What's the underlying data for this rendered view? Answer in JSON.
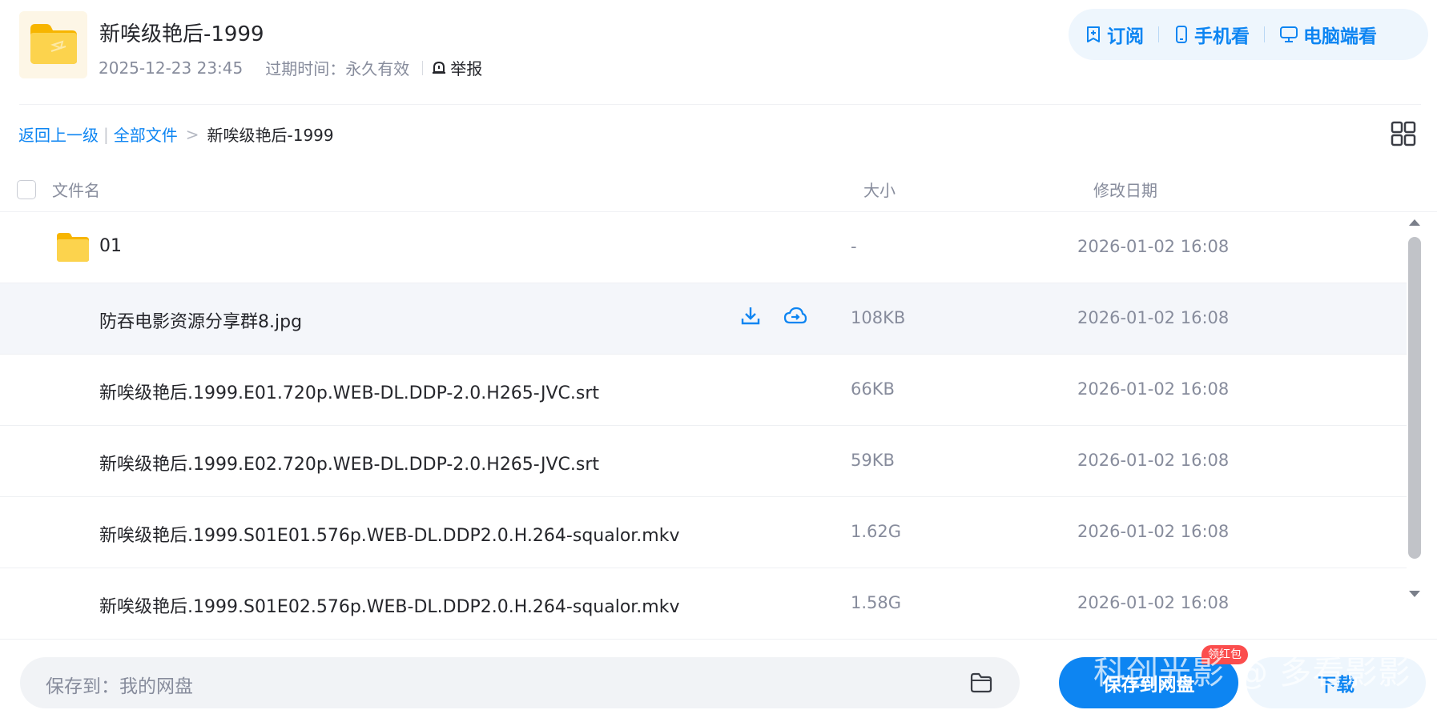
{
  "share": {
    "title": "新唉级艳后-1999",
    "created": "2025-12-23 23:45",
    "expire_label": "过期时间：永久有效",
    "report_label": "举报"
  },
  "top_actions": {
    "subscribe": "订阅",
    "mobile": "手机看",
    "desktop": "电脑端看"
  },
  "breadcrumb": {
    "back": "返回上一级",
    "all_files": "全部文件",
    "current": "新唉级艳后-1999"
  },
  "table": {
    "headers": {
      "name": "文件名",
      "size": "大小",
      "date": "修改日期"
    },
    "rows": [
      {
        "name": "01",
        "size": "-",
        "date": "2026-01-02 16:08",
        "type": "folder"
      },
      {
        "name": "防吞电影资源分享群8.jpg",
        "size": "108KB",
        "date": "2026-01-02 16:08",
        "type": "file"
      },
      {
        "name": "新唉级艳后.1999.E01.720p.WEB-DL.DDP-2.0.H265-JVC.srt",
        "size": "66KB",
        "date": "2026-01-02 16:08",
        "type": "file"
      },
      {
        "name": "新唉级艳后.1999.E02.720p.WEB-DL.DDP-2.0.H265-JVC.srt",
        "size": "59KB",
        "date": "2026-01-02 16:08",
        "type": "file"
      },
      {
        "name": "新唉级艳后.1999.S01E01.576p.WEB-DL.DDP2.0.H.264-squalor.mkv",
        "size": "1.62G",
        "date": "2026-01-02 16:08",
        "type": "file"
      },
      {
        "name": "新唉级艳后.1999.S01E02.576p.WEB-DL.DDP2.0.H.264-squalor.mkv",
        "size": "1.58G",
        "date": "2026-01-02 16:08",
        "type": "file"
      }
    ]
  },
  "footer": {
    "save_path": "保存到：我的网盘",
    "save_button": "保存到网盘",
    "red_packet": "领红包",
    "download_button": "下载",
    "watermark": "科创光影 @ 多看影影"
  },
  "colors": {
    "accent": "#0d85f2",
    "muted_text": "#878c9c",
    "folder_yellow": "#fccb3f",
    "badge_red": "#fb4d4d"
  },
  "icons": {
    "share": "folder-icon",
    "report": "alarm-icon",
    "subscribe": "subscribe-plus-icon",
    "mobile": "phone-icon",
    "desktop": "monitor-icon",
    "view_toggle": "grid-view-icon",
    "row_download": "download-icon",
    "row_save": "cloud-save-icon",
    "save_path": "folder-outline-icon"
  }
}
